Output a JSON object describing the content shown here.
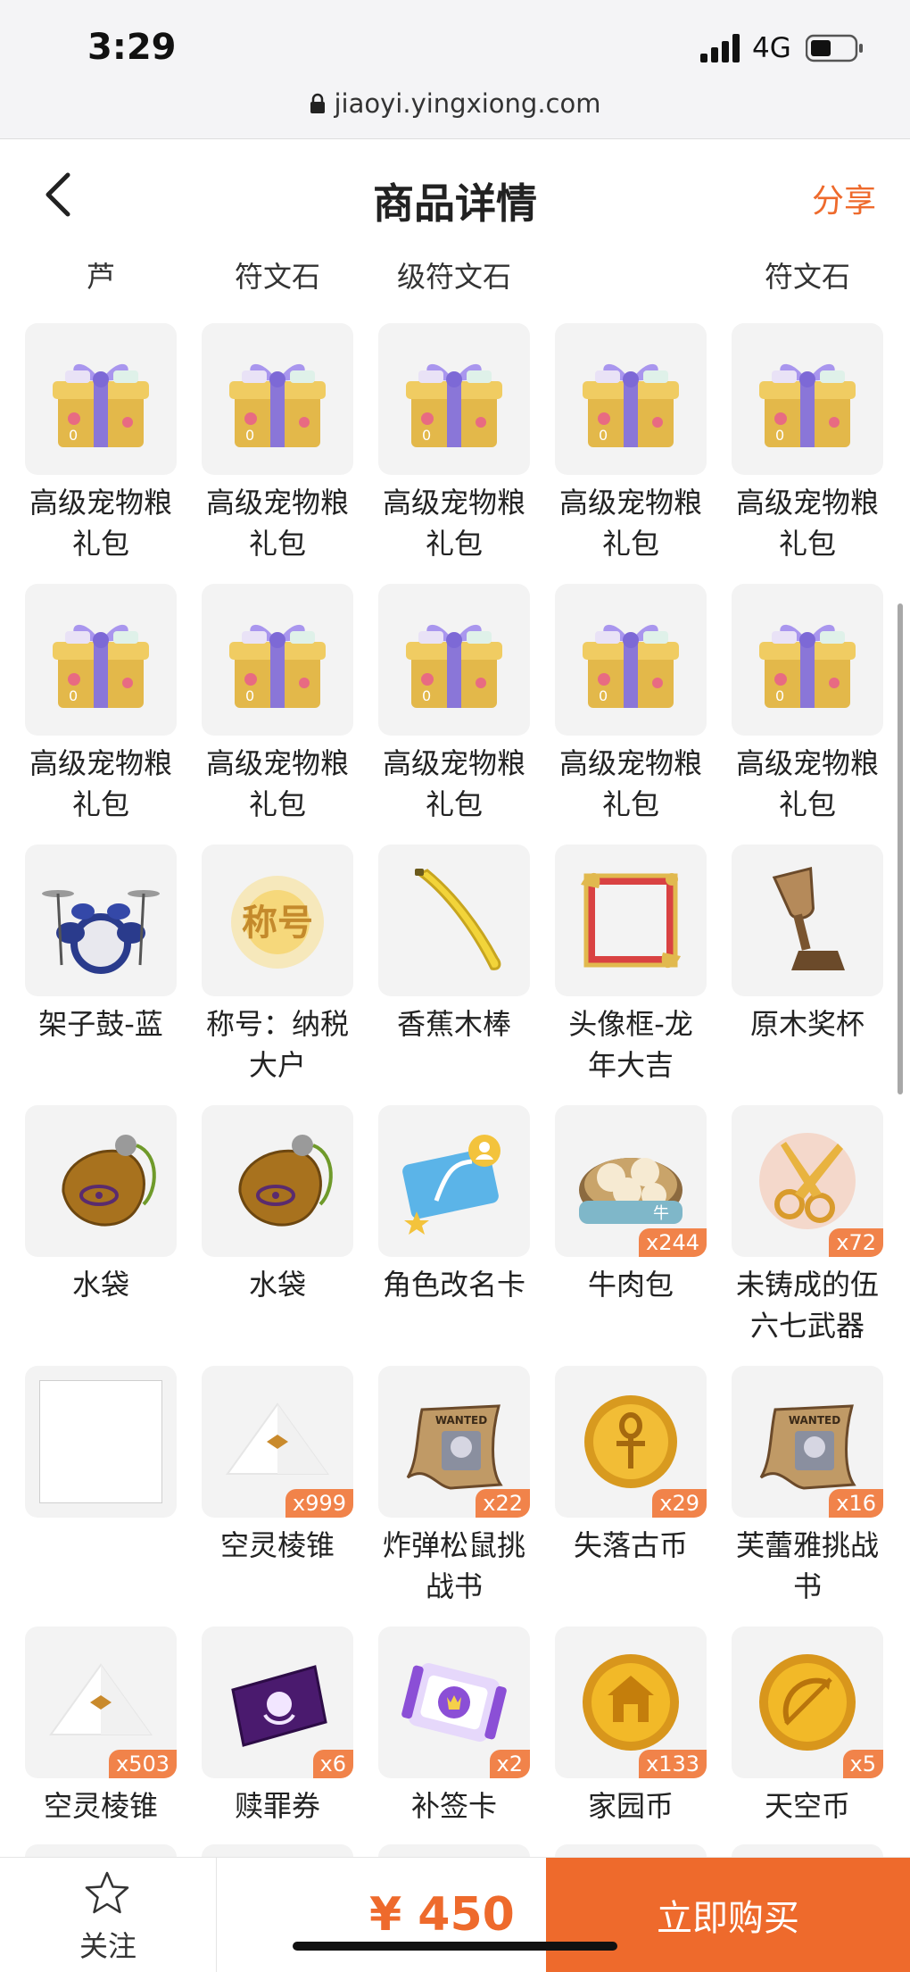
{
  "status_bar": {
    "time": "3:29",
    "network": "4G"
  },
  "browser": {
    "url": "jiaoyi.yingxiong.com"
  },
  "header": {
    "title": "商品详情",
    "share_label": "分享"
  },
  "top_labels": [
    "芦",
    "符文石",
    "级符文石",
    "",
    "符文石"
  ],
  "items": [
    {
      "name": "高级宠物粮礼包",
      "icon": "gift-box-icon",
      "qty": ""
    },
    {
      "name": "高级宠物粮礼包",
      "icon": "gift-box-icon",
      "qty": ""
    },
    {
      "name": "高级宠物粮礼包",
      "icon": "gift-box-icon",
      "qty": ""
    },
    {
      "name": "高级宠物粮礼包",
      "icon": "gift-box-icon",
      "qty": ""
    },
    {
      "name": "高级宠物粮礼包",
      "icon": "gift-box-icon",
      "qty": ""
    },
    {
      "name": "高级宠物粮礼包",
      "icon": "gift-box-icon",
      "qty": ""
    },
    {
      "name": "高级宠物粮礼包",
      "icon": "gift-box-icon",
      "qty": ""
    },
    {
      "name": "高级宠物粮礼包",
      "icon": "gift-box-icon",
      "qty": ""
    },
    {
      "name": "高级宠物粮礼包",
      "icon": "gift-box-icon",
      "qty": ""
    },
    {
      "name": "高级宠物粮礼包",
      "icon": "gift-box-icon",
      "qty": ""
    },
    {
      "name": "架子鼓-蓝",
      "icon": "drum-kit-icon",
      "qty": ""
    },
    {
      "name": "称号：纳税大户",
      "icon": "title-badge-icon",
      "qty": "",
      "icon_text": "称号"
    },
    {
      "name": "香蕉木棒",
      "icon": "banana-icon",
      "qty": ""
    },
    {
      "name": "头像框-龙年大吉",
      "icon": "avatar-frame-icon",
      "qty": ""
    },
    {
      "name": "原木奖杯",
      "icon": "trophy-icon",
      "qty": ""
    },
    {
      "name": "水袋",
      "icon": "water-bag-icon",
      "qty": ""
    },
    {
      "name": "水袋",
      "icon": "water-bag-icon",
      "qty": ""
    },
    {
      "name": "角色改名卡",
      "icon": "rename-card-icon",
      "qty": ""
    },
    {
      "name": "牛肉包",
      "icon": "steamed-bun-icon",
      "qty": "x244",
      "icon_text": "牛"
    },
    {
      "name": "未铸成的伍六七武器",
      "icon": "scissors-icon",
      "qty": "x72"
    },
    {
      "name": "",
      "icon": "empty-image-icon",
      "qty": ""
    },
    {
      "name": "空灵棱锥",
      "icon": "pyramid-icon",
      "qty": "x999"
    },
    {
      "name": "炸弹松鼠挑战书",
      "icon": "wanted-scroll-icon",
      "qty": "x22",
      "icon_text": "WANTED"
    },
    {
      "name": "失落古币",
      "icon": "ancient-coin-icon",
      "qty": "x29"
    },
    {
      "name": "芙蕾雅挑战书",
      "icon": "wanted-scroll-icon",
      "qty": "x16",
      "icon_text": "WANTED"
    },
    {
      "name": "空灵棱锥",
      "icon": "pyramid-icon",
      "qty": "x503"
    },
    {
      "name": "赎罪券",
      "icon": "purple-ticket-icon",
      "qty": "x6"
    },
    {
      "name": "补签卡",
      "icon": "sign-in-card-icon",
      "qty": "x2"
    },
    {
      "name": "家园币",
      "icon": "home-coin-icon",
      "qty": "x133"
    },
    {
      "name": "天空币",
      "icon": "sky-coin-icon",
      "qty": "x5"
    }
  ],
  "bottom_bar": {
    "follow_label": "关注",
    "price": "¥ 450",
    "buy_label": "立即购买"
  },
  "colors": {
    "accent": "#ee6a2c",
    "badge": "#f1834a",
    "tile_bg": "#f3f3f3"
  }
}
